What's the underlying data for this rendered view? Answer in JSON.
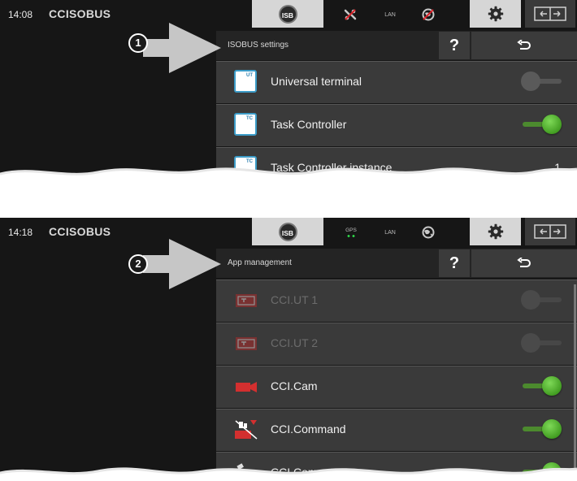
{
  "colors": {
    "accent_green": "#3f9a1f",
    "panel_bg": "#161616",
    "row_bg": "#3a3a3a",
    "highlight": "#d6d6d6"
  },
  "screen1": {
    "time": "14:08",
    "logo": "CCISOBUS",
    "isb_label": "ISB",
    "lan_label": "LAN",
    "callout_number": "1",
    "header_title": "ISOBUS settings",
    "help_label": "?",
    "rows": [
      {
        "label": "Universal terminal",
        "icon_text": "UT",
        "toggle": "off"
      },
      {
        "label": "Task Controller",
        "icon_text": "TC",
        "toggle": "on"
      },
      {
        "label": "Task Controller instance",
        "icon_text": "TC",
        "value": "1"
      }
    ]
  },
  "screen2": {
    "time": "14:18",
    "logo": "CCISOBUS",
    "isb_label": "ISB",
    "gps_label": "GPS",
    "lan_label": "LAN",
    "callout_number": "2",
    "header_title": "App management",
    "help_label": "?",
    "rows": [
      {
        "label": "CCI.UT 1",
        "icon": "ut-app-icon",
        "toggle": "off",
        "enabled": false
      },
      {
        "label": "CCI.UT 2",
        "icon": "ut-app-icon",
        "toggle": "off",
        "enabled": false
      },
      {
        "label": "CCI.Cam",
        "icon": "camera-app-icon",
        "toggle": "on",
        "enabled": true
      },
      {
        "label": "CCI.Command",
        "icon": "command-app-icon",
        "toggle": "on",
        "enabled": true
      },
      {
        "label": "CCI.Convert",
        "icon": "convert-app-icon",
        "toggle": "on",
        "enabled": true
      }
    ]
  }
}
